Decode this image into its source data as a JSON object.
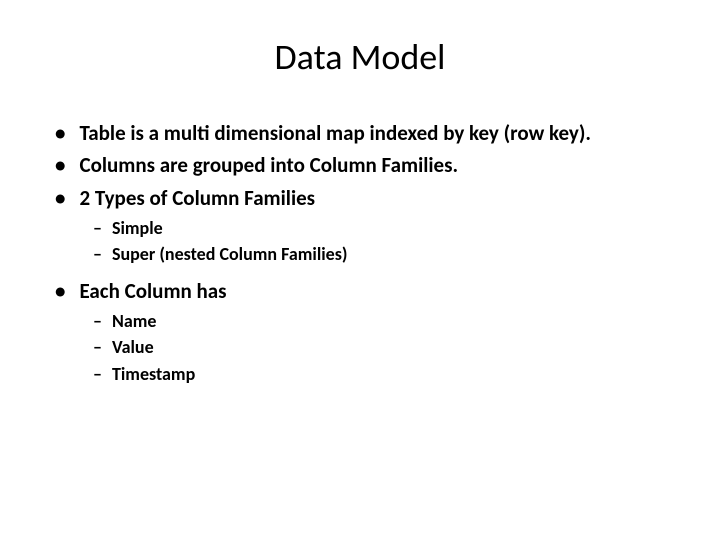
{
  "title": "Data Model",
  "bullets": {
    "b1": "Table is a multi dimensional map indexed by key (row key).",
    "b2": "Columns are grouped into Column Families.",
    "b3": "2 Types of Column Families",
    "b3_sub1": "Simple",
    "b3_sub2": "Super (nested Column Families)",
    "b4": "Each Column has",
    "b4_sub1": "Name",
    "b4_sub2": "Value",
    "b4_sub3": "Timestamp"
  }
}
